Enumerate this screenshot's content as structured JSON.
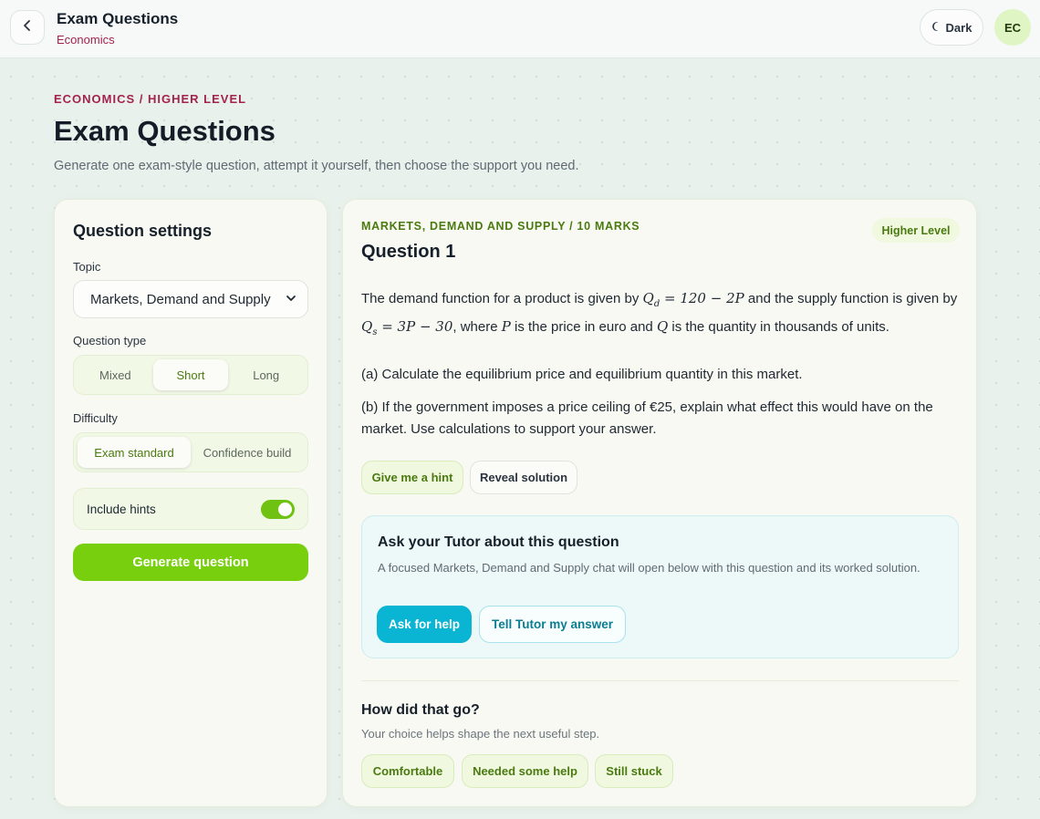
{
  "topbar": {
    "title": "Exam Questions",
    "subtitle": "Economics",
    "theme_label": "Dark",
    "avatar_initials": "EC"
  },
  "header": {
    "breadcrumb": "ECONOMICS / HIGHER LEVEL",
    "title": "Exam Questions",
    "description": "Generate one exam-style question, attempt it yourself, then choose the support you need."
  },
  "settings": {
    "heading": "Question settings",
    "topic_label": "Topic",
    "topic_value": "Markets, Demand and Supply",
    "type_label": "Question type",
    "type_options": [
      "Mixed",
      "Short",
      "Long"
    ],
    "type_selected": "Short",
    "difficulty_label": "Difficulty",
    "difficulty_options": [
      "Exam standard",
      "Confidence build"
    ],
    "difficulty_selected": "Exam standard",
    "hints_label": "Include hints",
    "hints_enabled": true,
    "generate_label": "Generate question"
  },
  "question": {
    "meta": "MARKETS, DEMAND AND SUPPLY / 10 MARKS",
    "level_badge": "Higher Level",
    "title": "Question 1",
    "intro": {
      "t1": "The demand function for a product is given by ",
      "m1": "Qₑ",
      "t2": " and the supply function is given by ",
      "t3": ", where ",
      "m3": "P",
      "t4": " is the price in euro and ",
      "m4": "Q",
      "t5": " is the quantity in thousands of units."
    },
    "part_a": "(a) Calculate the equilibrium price and equilibrium quantity in this market.",
    "part_b": "(b) If the government imposes a price ceiling of €25, explain what effect this would have on the market. Use calculations to support your answer.",
    "hint_label": "Give me a hint",
    "reveal_label": "Reveal solution"
  },
  "tutor": {
    "title": "Ask your Tutor about this question",
    "description": "A focused Markets, Demand and Supply chat will open below with this question and its worked solution.",
    "ask_label": "Ask for help",
    "tell_label": "Tell Tutor my answer"
  },
  "feedback": {
    "title": "How did that go?",
    "description": "Your choice helps shape the next useful step.",
    "options": [
      "Comfortable",
      "Needed some help",
      "Still stuck"
    ]
  },
  "colors": {
    "accent_green": "#78cf0e",
    "brand_crimson": "#a3234f",
    "tutor_cyan": "#0ab5d3"
  }
}
